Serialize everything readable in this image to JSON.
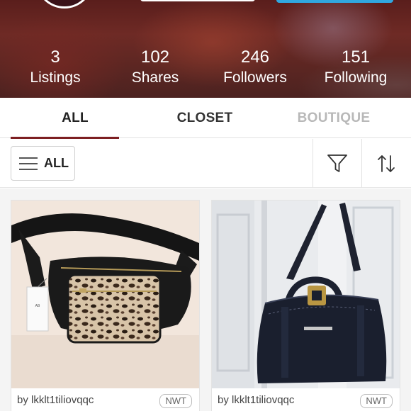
{
  "stats": [
    {
      "value": "3",
      "label": "Listings"
    },
    {
      "value": "102",
      "label": "Shares"
    },
    {
      "value": "246",
      "label": "Followers"
    },
    {
      "value": "151",
      "label": "Following"
    }
  ],
  "tabs": [
    {
      "label": "ALL",
      "active": true
    },
    {
      "label": "CLOSET",
      "active": false
    },
    {
      "label": "BOUTIQUE",
      "active": false
    }
  ],
  "filter": {
    "all_label": "ALL",
    "filter_icon": "filter-funnel-icon",
    "sort_icon": "sort-arrows-icon"
  },
  "listings": [
    {
      "seller": "by lkklt1tiliovqqc",
      "condition": "NWT",
      "item": "leopard print belt bag"
    },
    {
      "seller": "by lkklt1tiliovqqc",
      "condition": "NWT",
      "item": "black leather satchel"
    }
  ],
  "colors": {
    "tab_underline": "#7d1f22",
    "share_button": "#30a8e0"
  }
}
